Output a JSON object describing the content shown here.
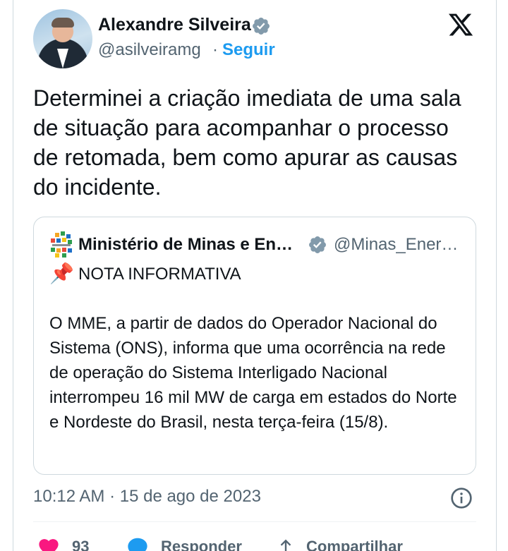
{
  "author": {
    "name": "Alexandre Silveira",
    "handle": "@asilveiramg",
    "separator": "·",
    "follow_label": "Seguir"
  },
  "tweet": {
    "text": "Determinei a criação imediata de uma sala de situação para acompanhar o processo de retomada, bem como apurar as causas do incidente."
  },
  "quote": {
    "name": "Ministério de Minas e En…",
    "handle": "@Minas_Ener…",
    "pin_icon": "📌",
    "title": "NOTA INFORMATIVA",
    "body": "O MME, a partir de dados do Operador Nacional do Sistema (ONS), informa que uma ocorrência na rede de operação do Sistema Interligado Nacional interrompeu 16 mil MW de carga em estados do Norte e Nordeste do Brasil, nesta terça-feira (15/8)."
  },
  "meta": {
    "timestamp": "10:12 AM · 15 de ago de 2023"
  },
  "actions": {
    "like_count": "93",
    "reply_label": "Responder",
    "share_label": "Compartilhar"
  },
  "colors": {
    "accent": "#1d9bf0",
    "like": "#f91880",
    "muted": "#536471"
  }
}
